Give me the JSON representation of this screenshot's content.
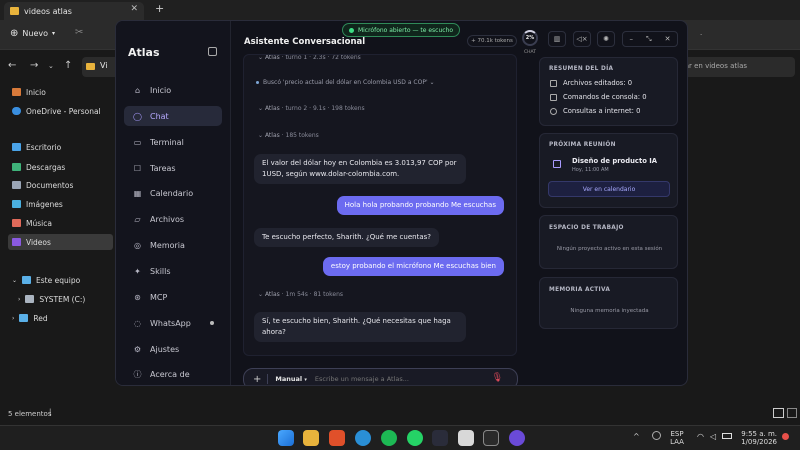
{
  "explorer": {
    "tab_title": "videos atlas",
    "new_label": "Nuevo",
    "address_label": "Vi",
    "search_placeholder": "Buscar en videos atlas",
    "tree": [
      {
        "label": "Inicio"
      },
      {
        "label": "OneDrive - Personal"
      },
      {
        "label": "Escritorio"
      },
      {
        "label": "Descargas"
      },
      {
        "label": "Documentos"
      },
      {
        "label": "Imágenes"
      },
      {
        "label": "Música"
      },
      {
        "label": "Videos"
      },
      {
        "label": "Este equipo"
      },
      {
        "label": "SYSTEM (C:)"
      },
      {
        "label": "Red"
      }
    ],
    "status": "5 elementos"
  },
  "taskbar": {
    "lang": "ESP",
    "lang2": "LAA",
    "time": "9:55 a. m.",
    "date": "1/09/2026"
  },
  "atlas": {
    "brand": "Atlas",
    "title": "Asistente Conversacional",
    "mic_status": "Micrófono abierto — te escucho",
    "tokens": "70.1k tokens",
    "context_pct": "2%",
    "context_label": "CHAT",
    "nav": [
      {
        "label": "Inicio",
        "icon": "home-icon"
      },
      {
        "label": "Chat",
        "icon": "chat-icon"
      },
      {
        "label": "Terminal",
        "icon": "terminal-icon"
      },
      {
        "label": "Tareas",
        "icon": "tasks-icon"
      },
      {
        "label": "Calendario",
        "icon": "calendar-icon"
      },
      {
        "label": "Archivos",
        "icon": "files-icon"
      },
      {
        "label": "Memoria",
        "icon": "memory-icon"
      },
      {
        "label": "Skills",
        "icon": "skills-icon"
      },
      {
        "label": "MCP",
        "icon": "mcp-icon"
      },
      {
        "label": "WhatsApp",
        "icon": "whatsapp-icon"
      },
      {
        "label": "Ajustes",
        "icon": "settings-icon"
      },
      {
        "label": "Acerca de",
        "icon": "info-icon"
      }
    ],
    "chat": {
      "meta1": {
        "who": "Atlas",
        "turn": "turno 1",
        "time": "2.3s",
        "tokens": "72 tokens"
      },
      "search_note": "Buscó 'precio actual del dólar en Colombia USD a COP'",
      "meta2": {
        "who": "Atlas",
        "turn": "turno 2",
        "time": "9.1s",
        "tokens": "198 tokens"
      },
      "meta3": {
        "who": "Atlas",
        "tokens": "185 tokens"
      },
      "msg1": "El valor del dólar hoy en Colombia es 3.013,97 COP por 1USD, según www.dolar-colombia.com.",
      "msg2": "Hola hola probando probando Me escuchas",
      "msg3": "Te escucho perfecto, Sharith. ¿Qué me cuentas?",
      "msg4": "estoy probando el micrófono Me escuchas bien",
      "meta4": {
        "who": "Atlas",
        "time": "1m 54s",
        "tokens": "81 tokens"
      },
      "msg5": "Sí, te escucho bien, Sharith. ¿Qué necesitas que haga ahora?"
    },
    "input": {
      "mode": "Manual",
      "placeholder": "Escribe un mensaje a Atlas..."
    },
    "summary": {
      "title": "RESUMEN DEL DÍA",
      "rows": [
        "Archivos editados: 0",
        "Comandos de consola: 0",
        "Consultas a internet: 0"
      ]
    },
    "meeting": {
      "title": "PRÓXIMA REUNIÓN",
      "name": "Diseño de producto IA",
      "when": "Hoy, 11:00 AM",
      "button": "Ver en calendario"
    },
    "workspace": {
      "title": "ESPACIO DE TRABAJO",
      "empty": "Ningún proyecto activo en esta sesión"
    },
    "memory": {
      "title": "MEMORIA ACTIVA",
      "empty": "Ninguna memoria inyectada"
    }
  },
  "colors": {
    "accent": "#6c6bf0",
    "mic_green": "#3ddc84",
    "window_bg": "#11121a"
  }
}
